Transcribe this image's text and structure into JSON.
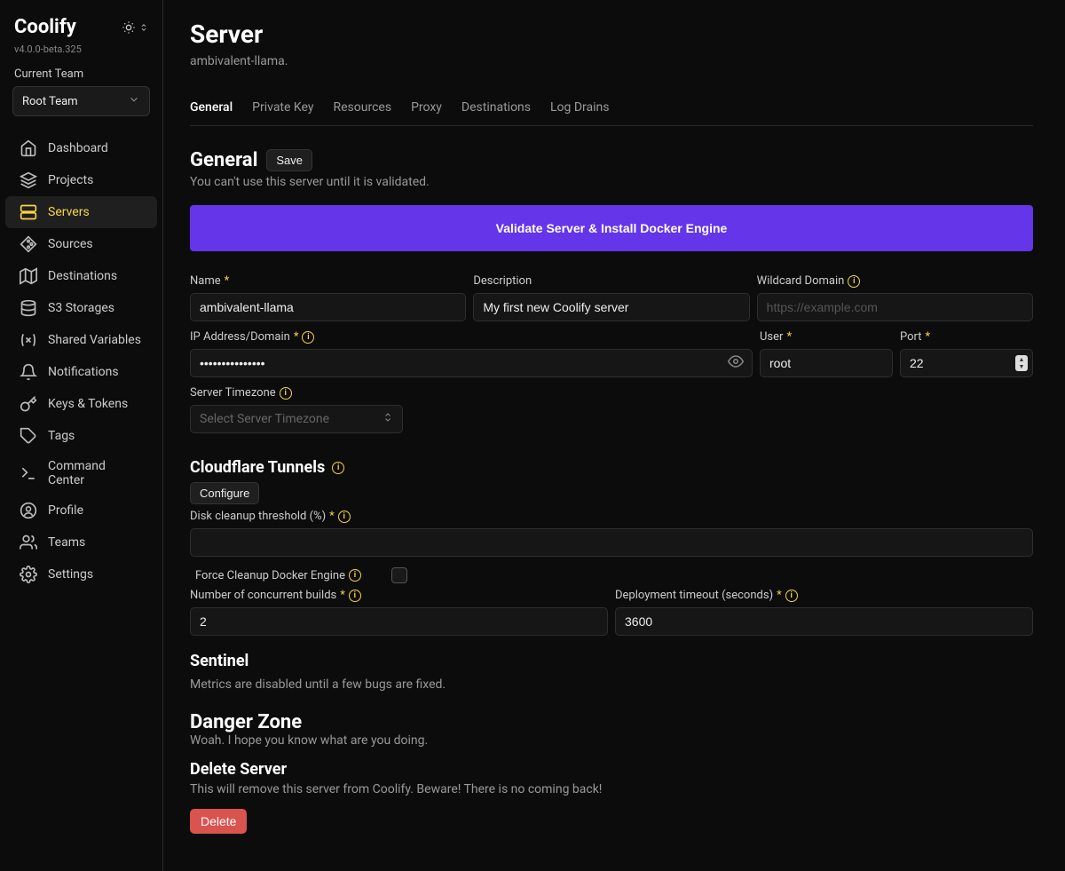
{
  "brand": {
    "name": "Coolify",
    "version": "v4.0.0-beta.325"
  },
  "team": {
    "label": "Current Team",
    "selected": "Root Team"
  },
  "sidebar": {
    "items": [
      {
        "label": "Dashboard"
      },
      {
        "label": "Projects"
      },
      {
        "label": "Servers"
      },
      {
        "label": "Sources"
      },
      {
        "label": "Destinations"
      },
      {
        "label": "S3 Storages"
      },
      {
        "label": "Shared Variables"
      },
      {
        "label": "Notifications"
      },
      {
        "label": "Keys & Tokens"
      },
      {
        "label": "Tags"
      },
      {
        "label": "Command Center"
      },
      {
        "label": "Profile"
      },
      {
        "label": "Teams"
      },
      {
        "label": "Settings"
      }
    ]
  },
  "page": {
    "title": "Server",
    "subtitle": "ambivalent-llama."
  },
  "tabs": [
    "General",
    "Private Key",
    "Resources",
    "Proxy",
    "Destinations",
    "Log Drains"
  ],
  "general": {
    "heading": "General",
    "save": "Save",
    "desc": "You can't use this server until it is validated.",
    "validate_btn": "Validate Server & Install Docker Engine",
    "fields": {
      "name_label": "Name",
      "name_value": "ambivalent-llama",
      "desc_label": "Description",
      "desc_value": "My first new Coolify server",
      "wildcard_label": "Wildcard Domain",
      "wildcard_placeholder": "https://example.com",
      "ip_label": "IP Address/Domain",
      "ip_value": "•••••••••••••••",
      "user_label": "User",
      "user_value": "root",
      "port_label": "Port",
      "port_value": "22",
      "tz_label": "Server Timezone",
      "tz_placeholder": "Select Server Timezone"
    }
  },
  "cloudflare": {
    "heading": "Cloudflare Tunnels",
    "configure": "Configure",
    "disk_label": "Disk cleanup threshold (%)",
    "force_label": "Force Cleanup Docker Engine",
    "builds_label": "Number of concurrent builds",
    "builds_value": "2",
    "timeout_label": "Deployment timeout (seconds)",
    "timeout_value": "3600"
  },
  "sentinel": {
    "heading": "Sentinel",
    "desc": "Metrics are disabled until a few bugs are fixed."
  },
  "danger": {
    "heading": "Danger Zone",
    "desc": "Woah. I hope you know what are you doing.",
    "delete_heading": "Delete Server",
    "delete_desc": "This will remove this server from Coolify. Beware! There is no coming back!",
    "delete_btn": "Delete"
  }
}
